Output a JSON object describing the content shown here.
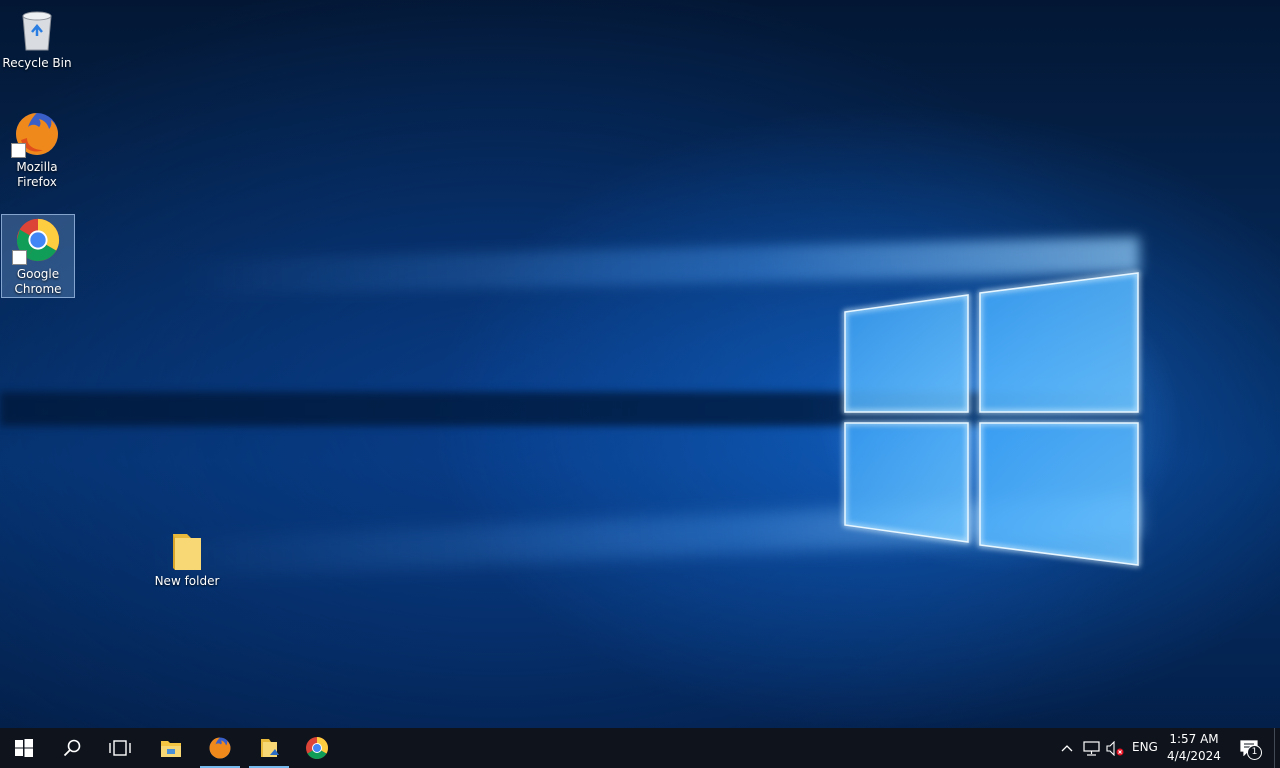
{
  "desktop": {
    "icons": [
      {
        "label": "Recycle Bin"
      },
      {
        "label": "Mozilla Firefox"
      },
      {
        "label": "Google Chrome"
      },
      {
        "label": "New folder"
      }
    ]
  },
  "taskbar": {
    "pinned": [
      "start-icon",
      "search-icon",
      "task-view-icon",
      "file-explorer-icon",
      "firefox-icon",
      "file-explorer-folder-icon",
      "chrome-icon"
    ],
    "tray": {
      "language": "ENG",
      "time": "1:57 AM",
      "date": "4/4/2024",
      "notification_count": "1"
    }
  },
  "colors": {
    "taskbar_bg": "#0f141c",
    "active_indicator": "#76b9ed",
    "wallpaper_accent": "#1e88e5"
  }
}
